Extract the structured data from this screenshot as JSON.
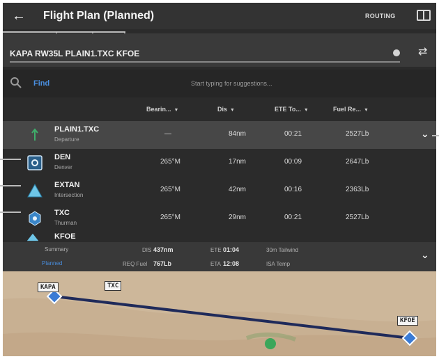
{
  "header": {
    "title": "Flight Plan (Planned)",
    "routing_label": "ROUTING",
    "back_icon": "arrow-left-icon",
    "panel_icon": "split-panel-icon"
  },
  "route": {
    "text": "KAPA RW35L PLAIN1.TXC KFOE"
  },
  "search": {
    "button_label": "Find",
    "hint": "Start typing for suggestions..."
  },
  "columns": [
    "Bearin...",
    "Dis",
    "ETE To...",
    "Fuel Re..."
  ],
  "waypoints": [
    {
      "name": "PLAIN1.TXC",
      "type": "Departure",
      "bearing": "—",
      "distance": "84nm",
      "ete": "00:21",
      "fuel": "2527Lb"
    },
    {
      "name": "DEN",
      "type": "Denver",
      "bearing": "265°M",
      "distance": "17nm",
      "ete": "00:09",
      "fuel": "2647Lb"
    },
    {
      "name": "EXTAN",
      "type": "Intersection",
      "bearing": "265°M",
      "distance": "42nm",
      "ete": "00:16",
      "fuel": "2363Lb"
    },
    {
      "name": "TXC",
      "type": "Thurman",
      "bearing": "265°M",
      "distance": "29nm",
      "ete": "00:21",
      "fuel": "2527Lb"
    },
    {
      "name": "KFOE",
      "type": "",
      "bearing": "",
      "distance": "",
      "ete": "",
      "fuel": ""
    }
  ],
  "summary": {
    "label": "Summary",
    "planned": "Planned",
    "dist_label": "DIS",
    "dist_value": "437nm",
    "fuel_label": "REQ Fuel",
    "fuel_value": "767Lb",
    "eta_label": "ETE",
    "eta_value": "01:04",
    "ete_label": "ETA",
    "ete_value": "12:08",
    "extra1": "30m Tailwind",
    "extra2": "ISA Temp"
  },
  "map": {
    "labels": [
      "KAPA",
      "TXC",
      "KFOE"
    ]
  },
  "colors": {
    "accent": "#4a90e2",
    "route_line": "#1f2a5a",
    "airport": "#3a7bd5",
    "header_bg": "#333333"
  }
}
